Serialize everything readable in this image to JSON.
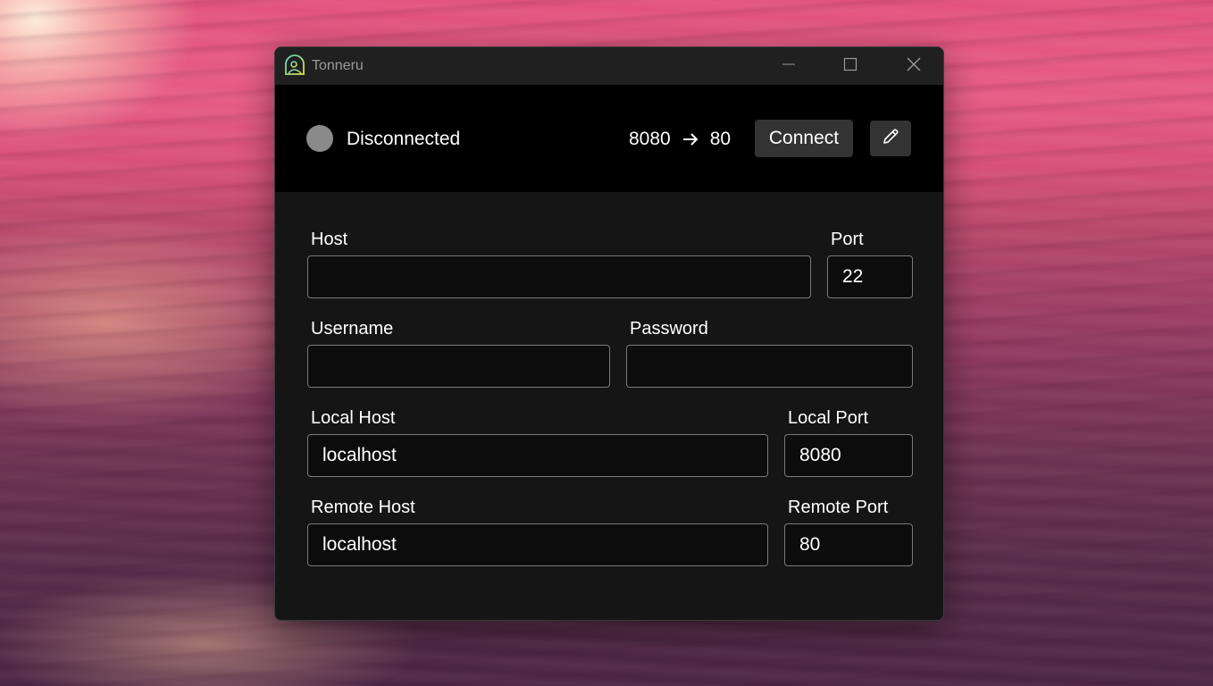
{
  "app": {
    "title": "Tonneru",
    "icon": "tonneru-logo-icon"
  },
  "window_controls": {
    "minimize": "minimize-icon",
    "maximize": "maximize-icon",
    "close": "close-icon"
  },
  "status": {
    "state": "Disconnected",
    "indicator_color": "#8a8a8a",
    "local_port": "8080",
    "remote_port": "80",
    "arrow_icon": "arrow-right-icon",
    "connect_label": "Connect",
    "edit_icon": "pencil-icon"
  },
  "form": {
    "host": {
      "label": "Host",
      "value": ""
    },
    "port": {
      "label": "Port",
      "value": "22"
    },
    "username": {
      "label": "Username",
      "value": ""
    },
    "password": {
      "label": "Password",
      "value": ""
    },
    "local_host": {
      "label": "Local Host",
      "value": "localhost"
    },
    "local_port": {
      "label": "Local Port",
      "value": "8080"
    },
    "remote_host": {
      "label": "Remote Host",
      "value": "localhost"
    },
    "remote_port": {
      "label": "Remote Port",
      "value": "80"
    }
  },
  "colors": {
    "window_bg": "#151515",
    "status_bar_bg": "#000000",
    "button_bg": "#333333",
    "logo_accent": "#a8d44a"
  }
}
